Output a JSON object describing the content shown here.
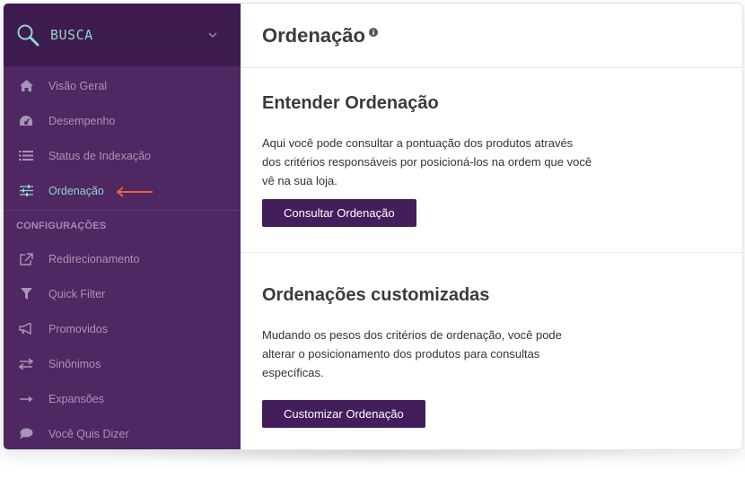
{
  "sidebar": {
    "title": "BUSCA",
    "items_top": [
      {
        "label": "Visão Geral",
        "icon": "home-icon"
      },
      {
        "label": "Desempenho",
        "icon": "dashboard-icon"
      },
      {
        "label": "Status de Indexação",
        "icon": "list-icon"
      },
      {
        "label": "Ordenação",
        "icon": "sliders-icon",
        "active": true
      }
    ],
    "section_label": "CONFIGURAÇÕES",
    "items_config": [
      {
        "label": "Redirecionamento",
        "icon": "external-link-icon"
      },
      {
        "label": "Quick Filter",
        "icon": "filter-icon"
      },
      {
        "label": "Promovidos",
        "icon": "megaphone-icon"
      },
      {
        "label": "Sinônimos",
        "icon": "exchange-icon"
      },
      {
        "label": "Expansões",
        "icon": "arrow-right-icon"
      },
      {
        "label": "Você Quis Dizer",
        "icon": "comment-icon"
      }
    ]
  },
  "main": {
    "title": "Ordenação",
    "section1": {
      "heading": "Entender Ordenação",
      "description": "Aqui você pode consultar a pontuação dos produtos através dos critérios responsáveis por posicioná-los na ordem que você vê na sua loja.",
      "button": "Consultar Ordenação"
    },
    "section2": {
      "heading": "Ordenações customizadas",
      "description": "Mudando os pesos dos critérios de ordenação, você pode alterar o posicionamento dos produtos para consultas específicas.",
      "button": "Customizar Ordenação"
    }
  },
  "colors": {
    "sidebar_bg": "#4f2763",
    "sidebar_head_bg": "#3d1b4f",
    "accent_teal": "#8fd6c5",
    "button_bg": "#441d5c",
    "annotation_arrow": "#e8603c"
  }
}
